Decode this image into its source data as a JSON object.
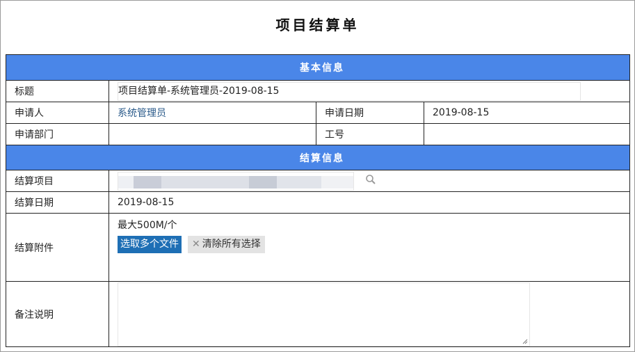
{
  "page": {
    "title": "项目结算单"
  },
  "basic_section": {
    "header": "基本信息",
    "title_label": "标题",
    "title_value": "项目结算单-系统管理员-2019-08-15",
    "applicant_label": "申请人",
    "applicant_value": "系统管理员",
    "apply_date_label": "申请日期",
    "apply_date_value": "2019-08-15",
    "department_label": "申请部门",
    "department_value": "",
    "employee_id_label": "工号",
    "employee_id_value": ""
  },
  "settlement_section": {
    "header": "结算信息",
    "project_label": "结算项目",
    "date_label": "结算日期",
    "date_value": "2019-08-15",
    "attachment_label": "结算附件",
    "attachment_limit": "最大500M/个",
    "select_files_button": "选取多个文件",
    "clear_selection_button": "清除所有选择",
    "remarks_label": "备注说明"
  },
  "colors": {
    "header_bg": "#4a86e8",
    "select_btn_bg": "#1e6fb5",
    "link_text": "#2a5a8a"
  },
  "icons": {
    "search": "search-icon",
    "clear": "close-icon"
  }
}
